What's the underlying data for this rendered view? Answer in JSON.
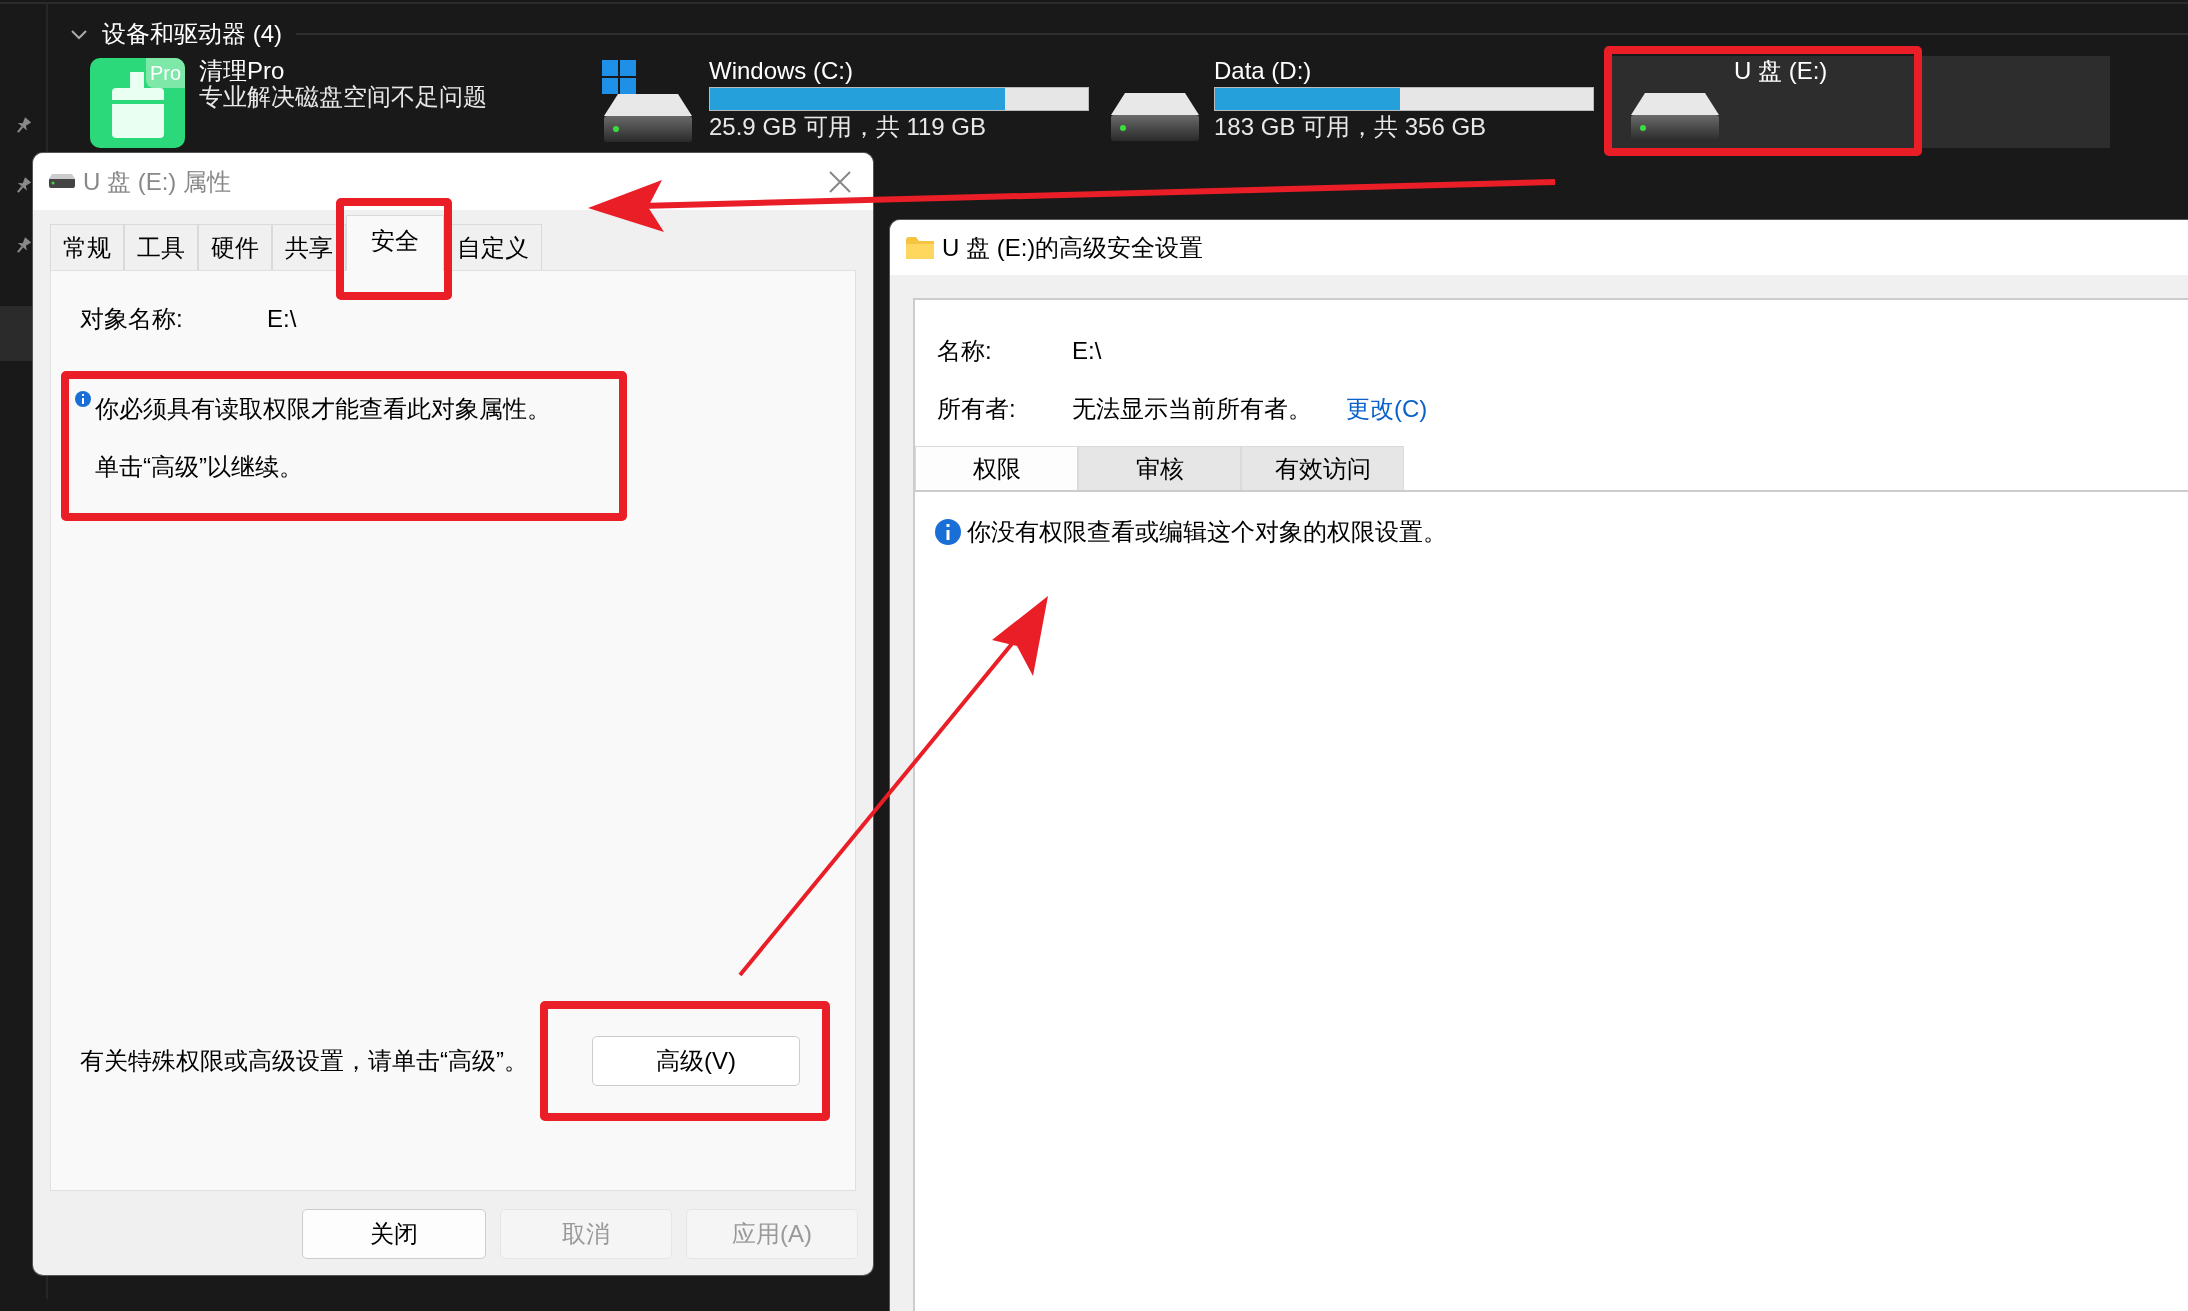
{
  "explorer": {
    "section": {
      "title": "设备和驱动器 (4)",
      "expanded": true
    },
    "drives": [
      {
        "kind": "app",
        "name": "清理Pro",
        "badge": "Pro",
        "subtitle": "专业解决磁盘空间不足问题",
        "selected": false,
        "highlighted": false
      },
      {
        "kind": "system",
        "name": "Windows (C:)",
        "level": 0.78,
        "subtitle": "25.9 GB 可用，共 119 GB",
        "selected": false,
        "highlighted": false
      },
      {
        "kind": "drive",
        "name": "Data (D:)",
        "level": 0.49,
        "subtitle": "183 GB 可用，共 356 GB",
        "selected": false,
        "highlighted": false
      },
      {
        "kind": "drive",
        "name": "U 盘 (E:)",
        "selected": true,
        "highlighted": true
      }
    ]
  },
  "properties_dialog": {
    "title": "U 盘 (E:) 属性",
    "tabs": [
      {
        "label": "常规",
        "selected": false,
        "highlighted": false
      },
      {
        "label": "工具",
        "selected": false,
        "highlighted": false
      },
      {
        "label": "硬件",
        "selected": false,
        "highlighted": false
      },
      {
        "label": "共享",
        "selected": false,
        "highlighted": false
      },
      {
        "label": "安全",
        "selected": true,
        "highlighted": true
      },
      {
        "label": "自定义",
        "selected": false,
        "highlighted": false
      }
    ],
    "object_label": "对象名称:",
    "object_value": "E:\\",
    "notice": {
      "lines": [
        "你必须具有读取权限才能查看此对象属性。",
        "单击“高级”以继续。"
      ],
      "highlighted": true
    },
    "advanced_hint": "有关特殊权限或高级设置，请单击“高级”。",
    "advanced_button": {
      "label": "高级(V)",
      "highlighted": true
    },
    "buttons": [
      {
        "label": "关闭",
        "disabled": false
      },
      {
        "label": "取消",
        "disabled": true
      },
      {
        "label": "应用(A)",
        "disabled": true
      }
    ]
  },
  "advanced_dialog": {
    "title": "U 盘 (E:)的高级安全设置",
    "fields": [
      {
        "label": "名称:",
        "value": "E:\\"
      },
      {
        "label": "所有者:",
        "value": "无法显示当前所有者。",
        "link": "更改(C)"
      }
    ],
    "tabs": [
      {
        "label": "权限",
        "selected": true
      },
      {
        "label": "审核",
        "selected": false
      },
      {
        "label": "有效访问",
        "selected": false
      }
    ],
    "message": "你没有权限查看或编辑这个对象的权限设置。"
  }
}
